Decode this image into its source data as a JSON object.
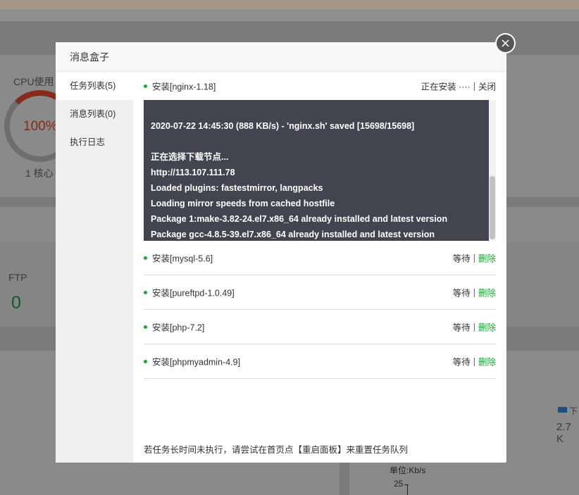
{
  "background": {
    "cpu_label": "CPU使用",
    "cpu_value": "100%",
    "cpu_cores": "1 核心",
    "ftp_label": "FTP",
    "ftp_value": "0",
    "net_legend": "下",
    "net_value": "2.7 K",
    "unit_label": "单位:Kb/s",
    "axis_tick": "25"
  },
  "modal": {
    "title": "消息盒子",
    "close_symbol": "×",
    "sidebar": [
      {
        "label": "任务列表(5)",
        "active": true
      },
      {
        "label": "消息列表(0)",
        "active": false
      },
      {
        "label": "执行日志",
        "active": false
      }
    ],
    "tasks": [
      {
        "name": "安装[nginx-1.18]",
        "status": "正在安装 ···· ",
        "action": "关闭"
      },
      {
        "name": "安装[mysql-5.6]",
        "status": "等待",
        "action": "删除"
      },
      {
        "name": "安装[pureftpd-1.0.49]",
        "status": "等待",
        "action": "删除"
      },
      {
        "name": "安装[php-7.2]",
        "status": "等待",
        "action": "删除"
      },
      {
        "name": "安装[phpmyadmin-4.9]",
        "status": "等待",
        "action": "删除"
      }
    ],
    "log_lines": [
      "2020-07-22 14:45:30 (888 KB/s) - 'nginx.sh' saved [15698/15698]",
      "",
      "正在选择下载节点...",
      "http://113.107.111.78",
      "Loaded plugins: fastestmirror, langpacks",
      "Loading mirror speeds from cached hostfile",
      "Package 1:make-3.82-24.el7.x86_64 already installed and latest version",
      "Package gcc-4.8.5-39.el7.x86_64 already installed and latest version"
    ],
    "tip": "若任务长时间未执行，请尝试在首页点【重启面板】来重置任务队列"
  }
}
